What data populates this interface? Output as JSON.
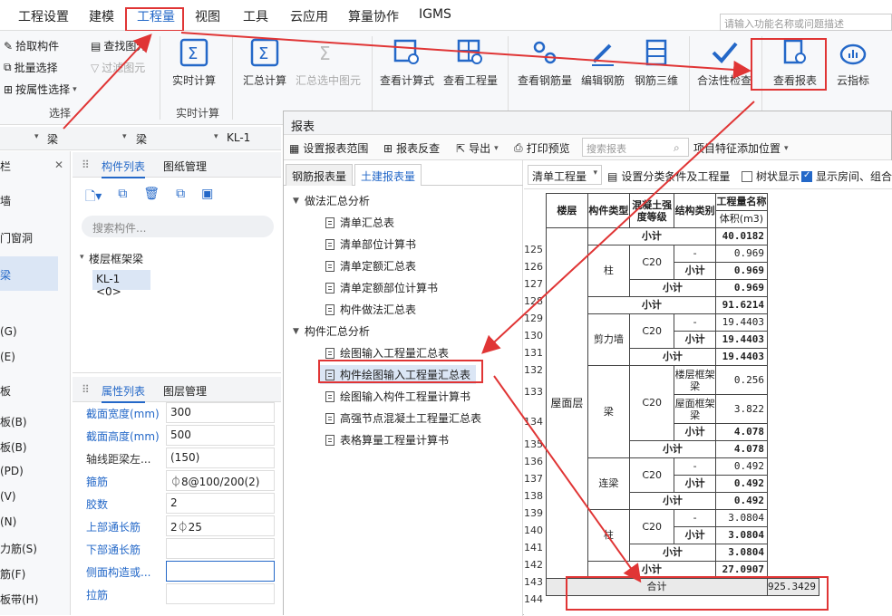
{
  "menu": {
    "items": [
      "工程设置",
      "建模",
      "工程量",
      "视图",
      "工具",
      "云应用",
      "算量协作",
      "IGMS"
    ],
    "search_placeholder": "请输入功能名称或问题描述"
  },
  "ribbon": {
    "small": [
      "拾取构件",
      "批量选择",
      "按属性选择",
      "查找图元",
      "过滤图元"
    ],
    "group_select": "选择",
    "group_realtime": "实时计算",
    "big": [
      "实时计算",
      "汇总计算",
      "汇总选中图元",
      "查看计算式",
      "查看工程量",
      "查看钢筋量",
      "编辑钢筋",
      "钢筋三维",
      "合法性检查",
      "查看报表",
      "云指标"
    ]
  },
  "filter": {
    "sel1": "梁",
    "sel2": "梁",
    "sel3": "KL-1"
  },
  "left_edge": {
    "items": [
      "栏",
      "墙",
      "门窗洞",
      "梁",
      "(G)",
      "(E)",
      "板",
      "板(B)",
      "板(B)",
      "(PD)",
      "(V)",
      "(N)",
      "力筋(S)",
      "筋(F)",
      "板带(H)"
    ]
  },
  "component_list": {
    "tab_active": "构件列表",
    "tab_other": "图纸管理",
    "search_placeholder": "搜索构件...",
    "group": "楼层框架梁",
    "item": "KL-1 <0>"
  },
  "properties": {
    "tab_active": "属性列表",
    "tab_other": "图层管理",
    "rows": [
      {
        "name": "截面宽度(mm)",
        "value": "300",
        "blue": true
      },
      {
        "name": "截面高度(mm)",
        "value": "500",
        "blue": true
      },
      {
        "name": "轴线距梁左...",
        "value": "(150)",
        "blue": false
      },
      {
        "name": "箍筋",
        "value": "⏀8@100/200(2)",
        "blue": true
      },
      {
        "name": "胶数",
        "value": "2",
        "blue": true
      },
      {
        "name": "上部通长筋",
        "value": "2⏀25",
        "blue": true
      },
      {
        "name": "下部通长筋",
        "value": "",
        "blue": true
      },
      {
        "name": "侧面构造或...",
        "value": "",
        "blue": true
      },
      {
        "name": "拉筋",
        "value": "",
        "blue": true
      }
    ]
  },
  "report": {
    "title": "报表",
    "toolbar": [
      "设置报表范围",
      "报表反查",
      "导出",
      "打印预览"
    ],
    "search_placeholder": "搜索报表",
    "feature_pos": "项目特征添加位置",
    "tree_tabs": [
      "钢筋报表量",
      "土建报表量"
    ],
    "sections": [
      {
        "name": "做法汇总分析",
        "items": [
          "清单汇总表",
          "清单部位计算书",
          "清单定额汇总表",
          "清单定额部位计算书",
          "构件做法汇总表"
        ]
      },
      {
        "name": "构件汇总分析",
        "items": [
          "绘图输入工程量汇总表",
          "构件绘图输入工程量汇总表",
          "绘图输入构件工程量计算书",
          "高强节点混凝土工程量汇总表",
          "表格算量工程量计算书"
        ]
      }
    ],
    "selected_item": "构件绘图输入工程量汇总表",
    "right_tool": {
      "dropdown": "清单工程量",
      "setup": "设置分类条件及工程量",
      "tree_show": "树状显示",
      "show_rooms": "显示房间、组合"
    }
  },
  "table": {
    "headers": {
      "floor": "楼层",
      "type": "构件类型",
      "grade": "混凝土强度等级",
      "struct": "结构类别",
      "qty": "工程量名称",
      "vol": "体积(m3)"
    },
    "floor_name": "屋面层",
    "row_numbers": [
      "125",
      "126",
      "127",
      "128",
      "129",
      "130",
      "131",
      "132",
      "133",
      "134",
      "135",
      "136",
      "137",
      "138",
      "139",
      "140",
      "141",
      "142",
      "143",
      "144"
    ],
    "subtotal": "小计",
    "total": "合计",
    "dash": "-",
    "grade": "C20",
    "types": {
      "column": "柱",
      "wall": "剪力墙",
      "beam": "梁",
      "link": "连梁"
    },
    "beam_kinds": [
      "楼层框架梁",
      "屋面框架梁"
    ],
    "values": {
      "r125": "40.0182",
      "r126": "0.969",
      "r127": "0.969",
      "r128": "0.969",
      "r129": "91.6214",
      "r130": "19.4403",
      "r131": "19.4403",
      "r132": "19.4403",
      "r133": "0.256",
      "r134": "3.822",
      "r135": "4.078",
      "r136": "4.078",
      "r137": "0.492",
      "r138": "0.492",
      "r139": "0.492",
      "r140": "3.0804",
      "r141": "3.0804",
      "r142": "3.0804",
      "r143": "27.0907",
      "r144": "925.3429"
    }
  },
  "colors": {
    "accent": "#2468c8",
    "highlight": "#e03535"
  }
}
